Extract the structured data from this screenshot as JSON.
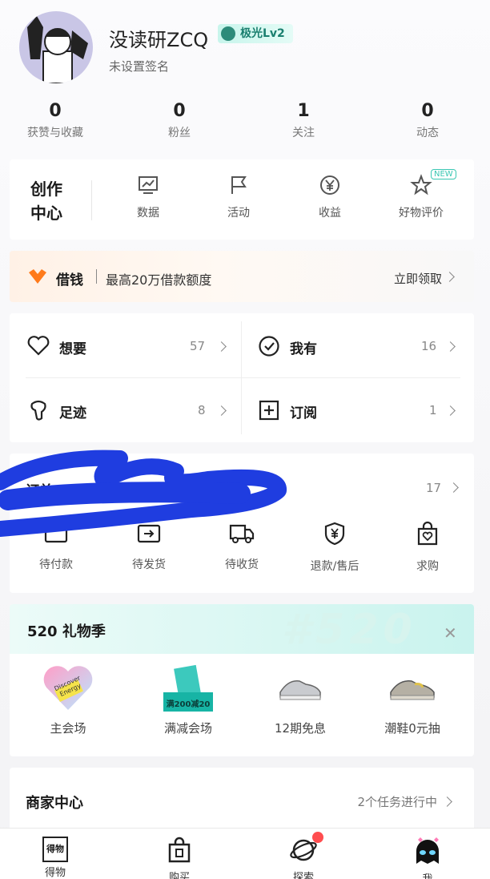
{
  "profile": {
    "username": "没读研ZCQ",
    "level_badge": "极光Lv2",
    "signature": "未设置签名"
  },
  "stats": [
    {
      "value": "0",
      "label": "获赞与收藏"
    },
    {
      "value": "0",
      "label": "粉丝"
    },
    {
      "value": "1",
      "label": "关注"
    },
    {
      "value": "0",
      "label": "动态"
    }
  ],
  "creator": {
    "title": "创作中心",
    "items": [
      {
        "label": "数据",
        "icon": "chart-icon"
      },
      {
        "label": "活动",
        "icon": "flag-icon"
      },
      {
        "label": "收益",
        "icon": "yen-icon"
      },
      {
        "label": "好物评价",
        "icon": "star-icon",
        "badge": "NEW"
      }
    ]
  },
  "loan": {
    "name": "借钱",
    "description": "最高20万借款额度",
    "action": "立即领取"
  },
  "collections": [
    {
      "label": "想要",
      "count": "57",
      "icon": "heart-icon"
    },
    {
      "label": "我有",
      "count": "16",
      "icon": "check-circle-icon"
    },
    {
      "label": "足迹",
      "count": "8",
      "icon": "footprint-icon"
    },
    {
      "label": "订阅",
      "count": "1",
      "icon": "plus-square-icon"
    }
  ],
  "orders": {
    "title": "订单",
    "count": "17",
    "items": [
      {
        "label": "待付款",
        "icon": "wallet-icon"
      },
      {
        "label": "待发货",
        "icon": "box-arrow-icon"
      },
      {
        "label": "待收货",
        "icon": "truck-icon"
      },
      {
        "label": "退款/售后",
        "icon": "shield-yen-icon"
      },
      {
        "label": "求购",
        "icon": "bag-heart-icon"
      }
    ]
  },
  "promo": {
    "title": "520 礼物季",
    "bg_text": "#520",
    "items": [
      {
        "label": "主会场",
        "image_text": "Discover Energy"
      },
      {
        "label": "满减会场",
        "image_text": "满200减20"
      },
      {
        "label": "12期免息"
      },
      {
        "label": "潮鞋0元抽"
      }
    ]
  },
  "merchant": {
    "title": "商家中心",
    "tasks": "2个任务进行中"
  },
  "nav": [
    {
      "label": "得物",
      "icon_text": "得物"
    },
    {
      "label": "购买"
    },
    {
      "label": "探索"
    },
    {
      "label": "我"
    }
  ],
  "colors": {
    "accent": "#3ac7b3",
    "loan_orange": "#ff7a1a",
    "notification_red": "#ff4d4f",
    "scribble_blue": "#1f3de0"
  }
}
